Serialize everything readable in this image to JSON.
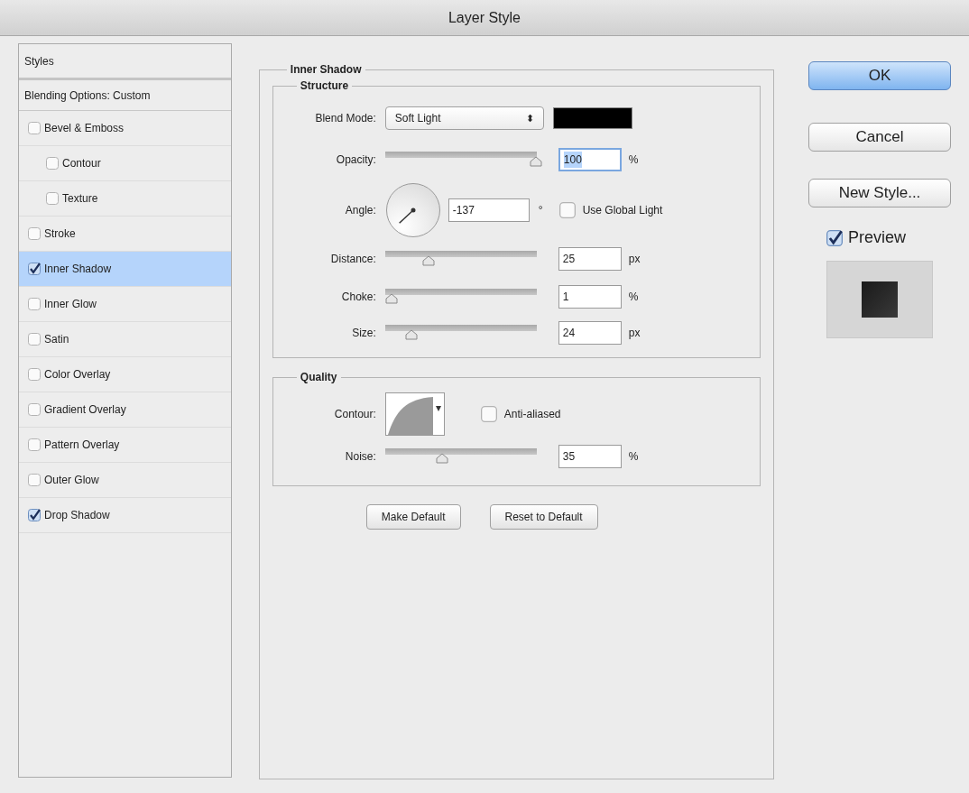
{
  "window": {
    "title": "Layer Style"
  },
  "styles_panel": {
    "header": "Styles",
    "blending_options": "Blending Options: Custom",
    "items": [
      {
        "label": "Bevel & Emboss",
        "checked": false,
        "selected": false,
        "children": [
          {
            "label": "Contour",
            "checked": false,
            "selected": false
          },
          {
            "label": "Texture",
            "checked": false,
            "selected": false
          }
        ]
      },
      {
        "label": "Stroke",
        "checked": false,
        "selected": false
      },
      {
        "label": "Inner Shadow",
        "checked": true,
        "selected": true
      },
      {
        "label": "Inner Glow",
        "checked": false,
        "selected": false
      },
      {
        "label": "Satin",
        "checked": false,
        "selected": false
      },
      {
        "label": "Color Overlay",
        "checked": false,
        "selected": false
      },
      {
        "label": "Gradient Overlay",
        "checked": false,
        "selected": false
      },
      {
        "label": "Pattern Overlay",
        "checked": false,
        "selected": false
      },
      {
        "label": "Outer Glow",
        "checked": false,
        "selected": false
      },
      {
        "label": "Drop Shadow",
        "checked": true,
        "selected": false
      }
    ]
  },
  "effect": {
    "title": "Inner Shadow",
    "structure": {
      "title": "Structure",
      "blend_mode": {
        "label": "Blend Mode:",
        "value": "Soft Light",
        "arrows": "⬍"
      },
      "opacity": {
        "label": "Opacity:",
        "level": 1,
        "value": "100",
        "unit": "%",
        "highlighted": true
      },
      "angle": {
        "label": "Angle:",
        "value": "-137",
        "unit": "°",
        "global_light": {
          "label": "Use Global Light",
          "checked": false
        }
      },
      "distance": {
        "label": "Distance:",
        "level": 0.26,
        "value": "25",
        "unit": "px",
        "highlighted": false
      },
      "choke": {
        "label": "Choke:",
        "level": 0,
        "value": "1",
        "unit": "%",
        "highlighted": false
      },
      "size": {
        "label": "Size:",
        "level": 0.14,
        "value": "24",
        "unit": "px",
        "highlighted": false
      }
    },
    "quality": {
      "title": "Quality",
      "contour": {
        "label": "Contour:",
        "anti_aliased": {
          "label": "Anti-aliased",
          "checked": false
        }
      },
      "noise": {
        "label": "Noise:",
        "level": 0.35,
        "value": "35",
        "unit": "%",
        "highlighted": false
      }
    },
    "buttons": [
      "Make Default",
      "Reset to Default"
    ]
  },
  "actions": {
    "buttons": [
      {
        "label": "OK",
        "kind": "default"
      },
      {
        "label": "Cancel",
        "kind": "normal"
      },
      {
        "label": "New Style...",
        "kind": "normal"
      }
    ],
    "preview": {
      "label": "Preview",
      "checked": true
    }
  }
}
